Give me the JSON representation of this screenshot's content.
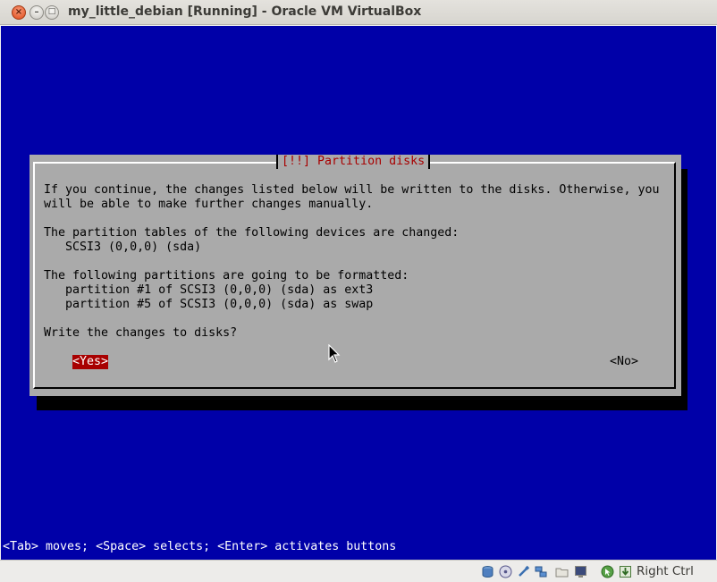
{
  "window": {
    "title": "my_little_debian [Running] - Oracle VM VirtualBox",
    "close_glyph": "×",
    "minimize_glyph": "–",
    "maximize_glyph": "□"
  },
  "dialog": {
    "title": "[!!] Partition disks",
    "lines": [
      "If you continue, the changes listed below will be written to the disks. Otherwise, you",
      "will be able to make further changes manually.",
      "The partition tables of the following devices are changed:",
      "   SCSI3 (0,0,0) (sda)",
      "The following partitions are going to be formatted:",
      "   partition #1 of SCSI3 (0,0,0) (sda) as ext3",
      "   partition #5 of SCSI3 (0,0,0) (sda) as swap",
      "Write the changes to disks?"
    ],
    "yes_label": "<Yes>",
    "no_label": "<No>"
  },
  "help_line": "<Tab> moves; <Space> selects; <Enter> activates buttons",
  "statusbar": {
    "icons": [
      "hard-disk-icon",
      "optical-drive-icon",
      "usb-icon",
      "network-icon",
      "shared-folder-icon",
      "display-icon",
      "mouse-integration-icon",
      "keyboard-capture-icon"
    ],
    "host_key": "Right Ctrl"
  },
  "colors": {
    "screen_bg": "#0000a8",
    "dialog_bg": "#aaaaaa",
    "dialog_title": "#a80000",
    "selected_button_bg": "#a80000"
  }
}
